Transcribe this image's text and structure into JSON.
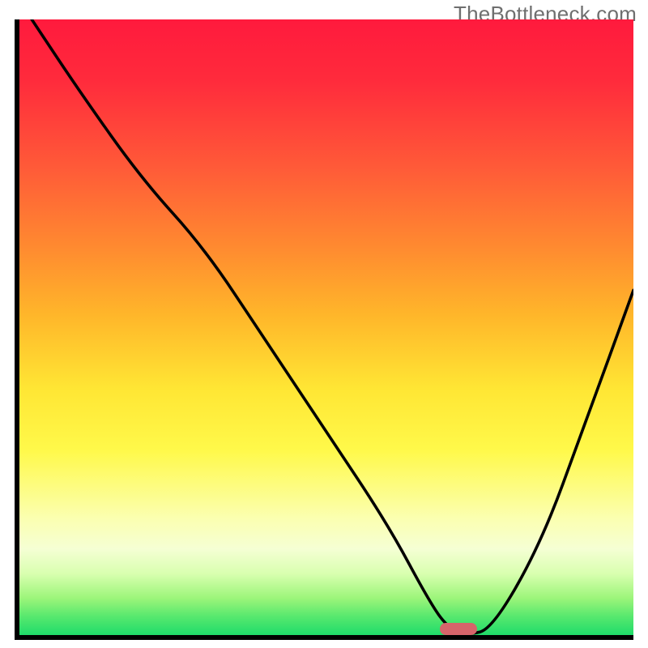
{
  "watermark": "TheBottleneck.com",
  "colors": {
    "gradient_top": "#ff1a3d",
    "gradient_mid": "#ffe634",
    "gradient_bottom": "#1fdc6a",
    "curve": "#000000",
    "border": "#000000",
    "marker": "#d6646a"
  },
  "chart_data": {
    "type": "line",
    "title": "",
    "xlabel": "",
    "ylabel": "",
    "xlim": [
      0,
      100
    ],
    "ylim": [
      0,
      100
    ],
    "grid": false,
    "legend": false,
    "series": [
      {
        "name": "bottleneck-curve",
        "x": [
          2,
          10,
          20,
          30,
          40,
          50,
          60,
          67,
          70,
          73,
          77,
          85,
          92,
          100
        ],
        "values": [
          100,
          88,
          74,
          63,
          48,
          33,
          18,
          5,
          1,
          0,
          1,
          15,
          34,
          56
        ]
      }
    ],
    "marker": {
      "x_center": 71.5,
      "y": 0,
      "width": 6,
      "height": 2
    }
  }
}
